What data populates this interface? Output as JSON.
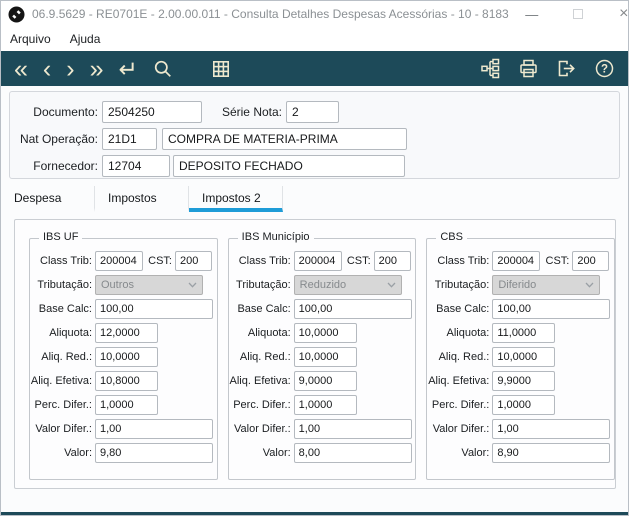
{
  "window": {
    "app_title": "06.9.5629 - RE0701E - 2.00.00.011 - Consulta Detalhes Despesas Acessórias - 10 - 8183",
    "controls": {
      "minimize": "—",
      "close": "×"
    }
  },
  "menu": {
    "arquivo": "Arquivo",
    "ajuda": "Ajuda"
  },
  "toolbar": {
    "nav": {
      "first": "«",
      "prev": "‹",
      "next": "›",
      "last": "»",
      "enter": "↵"
    },
    "icons": [
      "search",
      "grid",
      "structure",
      "print",
      "exit",
      "help"
    ],
    "help_glyph": "?"
  },
  "header": {
    "documento": {
      "label": "Documento:",
      "value": "2504250"
    },
    "serie_nota": {
      "label": "Série Nota:",
      "value": "2"
    },
    "nat_operacao": {
      "label": "Nat Operação:",
      "code": "21D1",
      "desc": "COMPRA DE MATERIA-PRIMA"
    },
    "fornecedor": {
      "label": "Fornecedor:",
      "code": "12704",
      "desc": "DEPOSITO FECHADO"
    }
  },
  "tabs": {
    "despesa": "Despesa",
    "impostos": "Impostos",
    "impostos2": "Impostos 2",
    "active": "Impostos 2"
  },
  "tax": {
    "labels": {
      "class_trib": "Class Trib:",
      "cst": "CST:",
      "tributacao": "Tributação:",
      "base_calc": "Base Calc:",
      "aliquota": "Aliquota:",
      "aliq_red": "Aliq. Red.:",
      "aliq_efetiva": "Aliq. Efetiva:",
      "perc_difer": "Perc. Difer.:",
      "valor_difer": "Valor Difer.:",
      "valor": "Valor:"
    },
    "groups": [
      {
        "title": "IBS UF",
        "class_trib": "200004",
        "cst": "200",
        "tributacao": "Outros",
        "base_calc": "100,00",
        "aliquota": "12,0000",
        "aliq_red": "10,0000",
        "aliq_efetiva": "10,8000",
        "perc_difer": "1,0000",
        "valor_difer": "1,00",
        "valor": "9,80"
      },
      {
        "title": "IBS Município",
        "class_trib": "200004",
        "cst": "200",
        "tributacao": "Reduzido",
        "base_calc": "100,00",
        "aliquota": "10,0000",
        "aliq_red": "10,0000",
        "aliq_efetiva": "9,0000",
        "perc_difer": "1,0000",
        "valor_difer": "1,00",
        "valor": "8,00"
      },
      {
        "title": "CBS",
        "class_trib": "200004",
        "cst": "200",
        "tributacao": "Diferido",
        "base_calc": "100,00",
        "aliquota": "11,0000",
        "aliq_red": "10,0000",
        "aliq_efetiva": "9,9000",
        "perc_difer": "1,0000",
        "valor_difer": "1,00",
        "valor": "8,90"
      }
    ]
  },
  "theme": {
    "toolbar_bg": "#1d4a59",
    "icon_color": "#efe9cf",
    "active_tab_accent": "#1e9cd7"
  }
}
